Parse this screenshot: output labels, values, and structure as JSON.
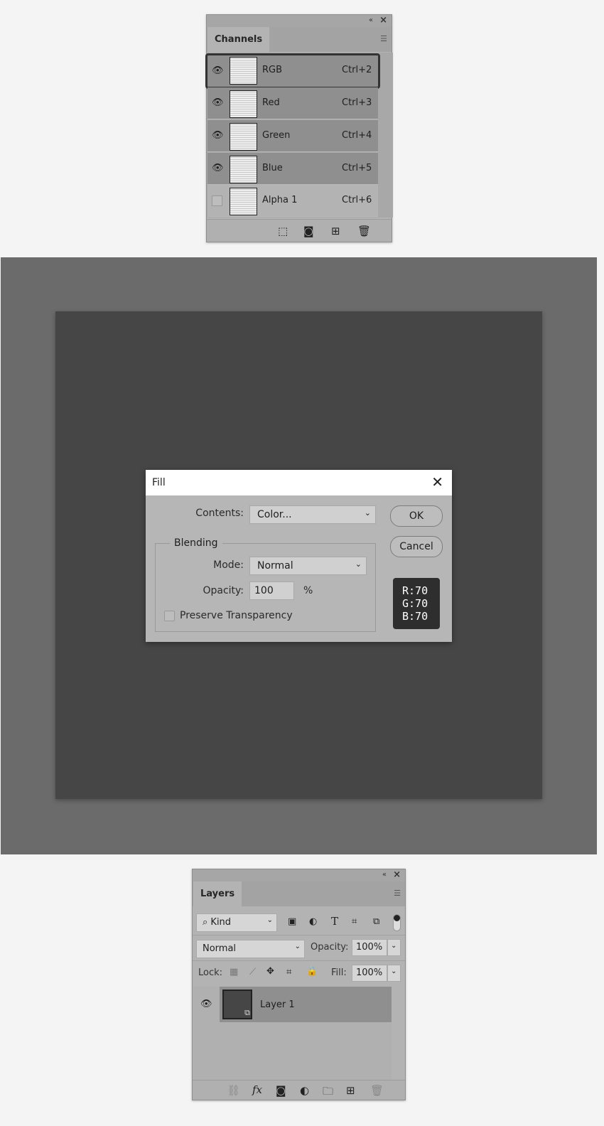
{
  "channels_panel": {
    "tab": "Channels",
    "rows": [
      {
        "name": "RGB",
        "shortcut": "Ctrl+2",
        "visible": true,
        "selected": true
      },
      {
        "name": "Red",
        "shortcut": "Ctrl+3",
        "visible": true
      },
      {
        "name": "Green",
        "shortcut": "Ctrl+4",
        "visible": true
      },
      {
        "name": "Blue",
        "shortcut": "Ctrl+5",
        "visible": true
      },
      {
        "name": "Alpha 1",
        "shortcut": "Ctrl+6",
        "visible": false
      }
    ],
    "footer_icons": [
      "load-selection-icon",
      "save-selection-icon",
      "new-channel-icon",
      "trash-icon"
    ]
  },
  "canvas": {
    "outer_color": "#6b6b6b",
    "document_color": "#464646"
  },
  "fill_dialog": {
    "title": "Fill",
    "contents_label": "Contents:",
    "contents_value": "Color...",
    "blending_label": "Blending",
    "mode_label": "Mode:",
    "mode_value": "Normal",
    "opacity_label": "Opacity:",
    "opacity_value": "100",
    "opacity_unit": "%",
    "preserve_label": "Preserve Transparency",
    "preserve_checked": false,
    "ok": "OK",
    "cancel": "Cancel",
    "color_note": {
      "r": "R:70",
      "g": "G:70",
      "b": "B:70"
    }
  },
  "layers_panel": {
    "tab": "Layers",
    "filter_value": "Kind",
    "blend_mode": "Normal",
    "opacity_label": "Opacity:",
    "opacity_value": "100%",
    "lock_label": "Lock:",
    "fill_label": "Fill:",
    "fill_value": "100%",
    "layers": [
      {
        "name": "Layer 1",
        "visible": true
      }
    ]
  }
}
